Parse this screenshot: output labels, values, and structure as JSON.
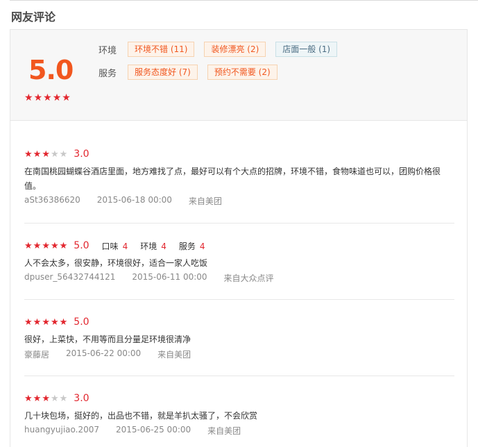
{
  "section": {
    "title": "网友评论"
  },
  "summary": {
    "score": "5.0",
    "stars_filled": 5,
    "rows": [
      {
        "label": "环境",
        "tags": [
          {
            "text": "环境不错 (11)",
            "kind": "positive"
          },
          {
            "text": "装修漂亮 (2)",
            "kind": "positive"
          },
          {
            "text": "店面一般 (1)",
            "kind": "neutral"
          }
        ]
      },
      {
        "label": "服务",
        "tags": [
          {
            "text": "服务态度好 (7)",
            "kind": "positive"
          },
          {
            "text": "预约不需要 (2)",
            "kind": "positive"
          }
        ]
      }
    ]
  },
  "reviews": [
    {
      "stars": 3,
      "score": "3.0",
      "sub_ratings": [],
      "text": "在南国桃园蝴蝶谷酒店里面，地方难找了点，最好可以有个大点的招牌，环境不错，食物味道也可以，团购价格很值。",
      "user": "aSt36386620",
      "date": "2015-06-18 00:00",
      "source": "来自美团"
    },
    {
      "stars": 5,
      "score": "5.0",
      "sub_ratings": [
        {
          "label": "口味",
          "value": "4"
        },
        {
          "label": "环境",
          "value": "4"
        },
        {
          "label": "服务",
          "value": "4"
        }
      ],
      "text": "人不会太多，很安静，环境很好，适合一家人吃饭",
      "user": "dpuser_56432744121",
      "date": "2015-06-11 00:00",
      "source": "来自大众点评"
    },
    {
      "stars": 5,
      "score": "5.0",
      "sub_ratings": [],
      "text": "很好，上菜快，不用等而且分量足环境很清净",
      "user": "豪藤居",
      "date": "2015-06-22 00:00",
      "source": "来自美团"
    },
    {
      "stars": 3,
      "score": "3.0",
      "sub_ratings": [],
      "text": "几十块包场，挺好的，出品也不错，就是羊扒太骚了，不会欣赏",
      "user": "huangyujiao.2007",
      "date": "2015-06-25 00:00",
      "source": "来自美团"
    }
  ],
  "colors": {
    "accent": "#f1571f",
    "star_on": "#e2262e",
    "star_off": "#c8c8c8",
    "summary_bg": "#f7f7f7"
  },
  "icons": {
    "star": "star-icon"
  }
}
